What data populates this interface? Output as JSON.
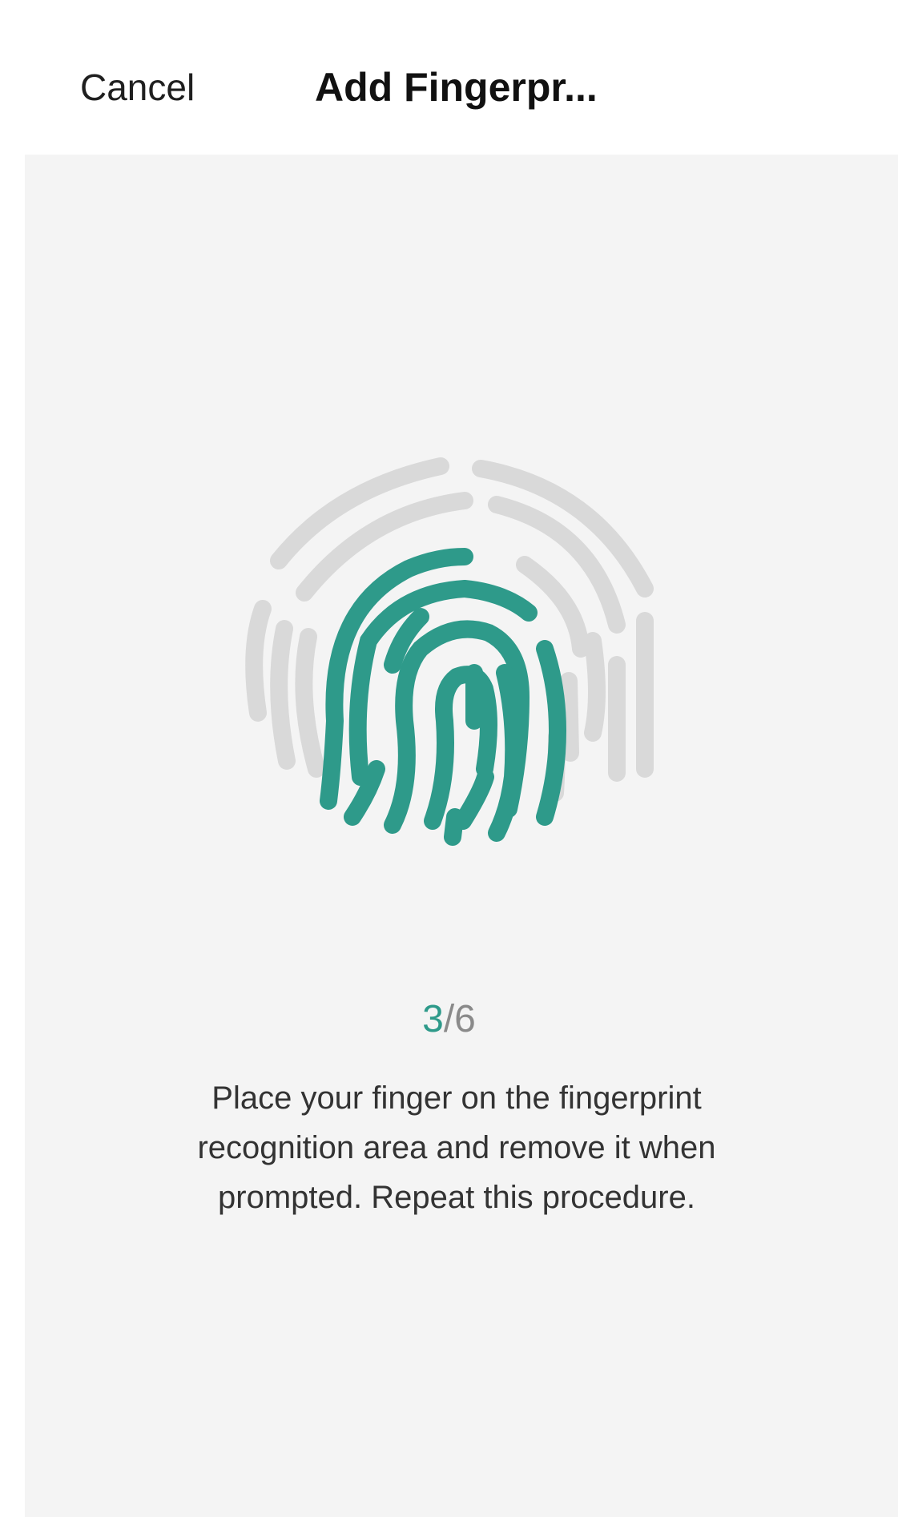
{
  "header": {
    "cancel_label": "Cancel",
    "title": "Add Fingerpr..."
  },
  "enrollment": {
    "current_step": "3",
    "separator": "/",
    "total_steps": "6",
    "progress_fraction": 0.5,
    "instructions": "Place your finger on the fingerprint recognition area and remove it when prompted. Repeat this procedure."
  },
  "icons": {
    "fingerprint": "fingerprint-icon"
  },
  "colors": {
    "accent": "#2e9a8a",
    "inactive_ridge": "#d9d9d9",
    "panel_bg": "#f4f4f4"
  }
}
